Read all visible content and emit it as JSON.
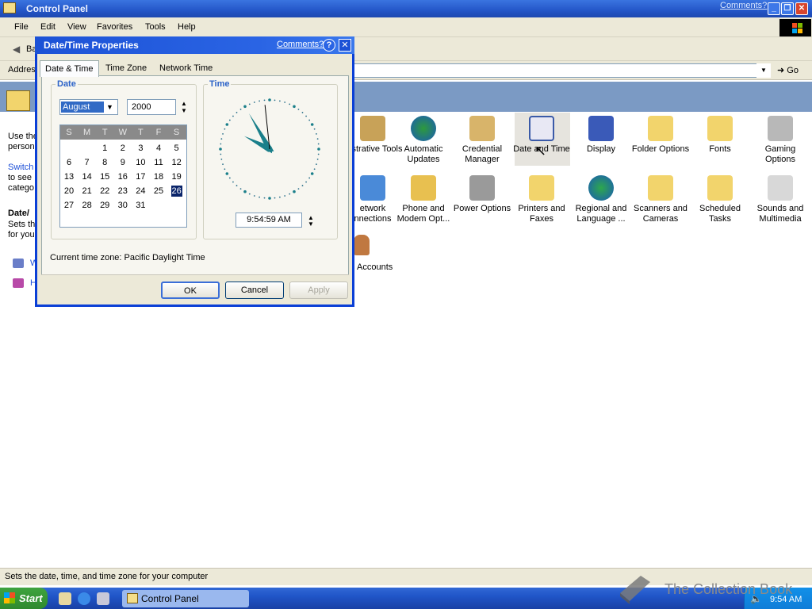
{
  "window": {
    "title": "Control Panel",
    "comments_link": "Comments?",
    "menu": [
      "File",
      "Edit",
      "View",
      "Favorites",
      "Tools",
      "Help"
    ],
    "toolbar_back": "Ba",
    "address_label": "Addres",
    "go_label": "Go"
  },
  "left_pane": {
    "text1": "Use the",
    "text2": "person",
    "switch_link": "Switch",
    "text3": "to see",
    "text4": "catego",
    "section_title": "Date/",
    "desc1": "Sets th",
    "desc2": "for you",
    "link_w": "W",
    "link_h": "H"
  },
  "icons": [
    {
      "label": "inistrative Tools"
    },
    {
      "label": "Automatic Updates"
    },
    {
      "label": "Credential Manager"
    },
    {
      "label": "Date and Time"
    },
    {
      "label": "Display"
    },
    {
      "label": "Folder Options"
    },
    {
      "label": "Fonts"
    },
    {
      "label": "Gaming Options"
    },
    {
      "label": "etwork nnections"
    },
    {
      "label": "Phone and Modem Opt..."
    },
    {
      "label": "Power Options"
    },
    {
      "label": "Printers and Faxes"
    },
    {
      "label": "Regional and Language ..."
    },
    {
      "label": "Scanners and Cameras"
    },
    {
      "label": "Scheduled Tasks"
    },
    {
      "label": "Sounds and Multimedia"
    },
    {
      "label": "Accounts"
    }
  ],
  "dialog": {
    "title": "Date/Time Properties",
    "comments_link": "Comments?",
    "help": "?",
    "close": "✕",
    "tabs": [
      "Date & Time",
      "Time Zone",
      "Network Time"
    ],
    "date_group": "Date",
    "time_group": "Time",
    "month": "August",
    "year": "2000",
    "weekdays": [
      "S",
      "M",
      "T",
      "W",
      "T",
      "F",
      "S"
    ],
    "days": [
      "1",
      "2",
      "3",
      "4",
      "5",
      "6",
      "7",
      "8",
      "9",
      "10",
      "11",
      "12",
      "13",
      "14",
      "15",
      "16",
      "17",
      "18",
      "19",
      "20",
      "21",
      "22",
      "23",
      "24",
      "25",
      "26",
      "27",
      "28",
      "29",
      "30",
      "31"
    ],
    "selected_day": "26",
    "time": "9:54:59 AM",
    "timezone_text": "Current time zone:  Pacific Daylight Time",
    "ok": "OK",
    "cancel": "Cancel",
    "apply": "Apply"
  },
  "status_bar": {
    "text": "Sets the date, time, and time zone for your computer"
  },
  "taskbar": {
    "start": "Start",
    "task_label": "Control Panel",
    "clock": "9:54 AM"
  },
  "watermark": "The Collection Book",
  "colors": {
    "title_blue": "#2456c8",
    "taskbar_blue": "#2055c8",
    "selection": "#316ac5",
    "clock_hands": "#1a7f8a"
  }
}
